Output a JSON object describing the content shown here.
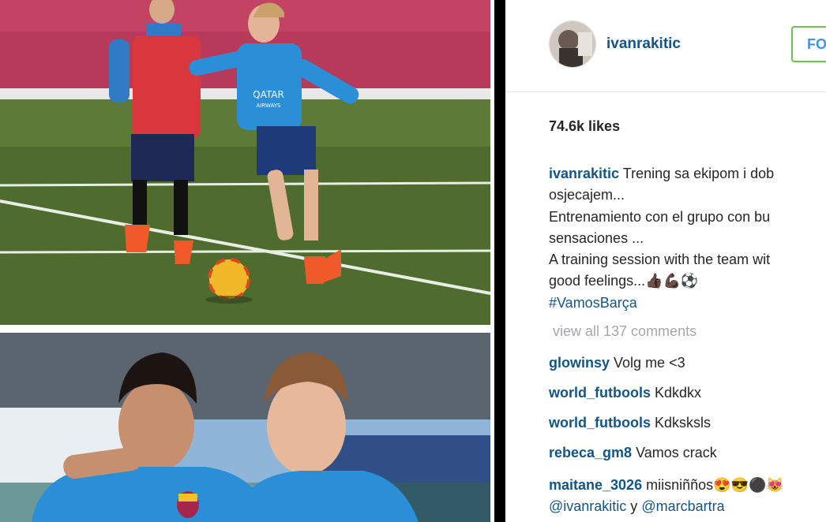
{
  "post": {
    "username": "ivanrakitic",
    "follow_label": "FO",
    "likes": "74.6k likes",
    "caption": {
      "username": "ivanrakitic",
      "lines": [
        "Trening sa ekipom i dob",
        "osjecajem...",
        "Entrenamiento con el grupo con bu",
        "sensaciones ...",
        "A training session with the team wit",
        "good feelings...👍🏿💪🏿⚽"
      ],
      "hashtag": "#VamosBarça"
    },
    "view_all_comments": "view all 137 comments",
    "comments": [
      {
        "user": "glowinsy",
        "text": "Volg me <3"
      },
      {
        "user": "world_futbools",
        "text": "Kdkdkx"
      },
      {
        "user": "world_futbools",
        "text": "Kdksksls"
      },
      {
        "user": "rebeca_gm8",
        "text": "Vamos crack"
      },
      {
        "user": "maitane_3026",
        "text": "miisniñños😍😎⚫😻"
      }
    ],
    "mentions": {
      "first": "@ivanrakitic",
      "joiner": " y ",
      "second": "@marcbartra"
    }
  },
  "photo_text": {
    "shirt_sponsor": "QATAR",
    "shirt_sponsor_sub": "AIRWAYS"
  }
}
